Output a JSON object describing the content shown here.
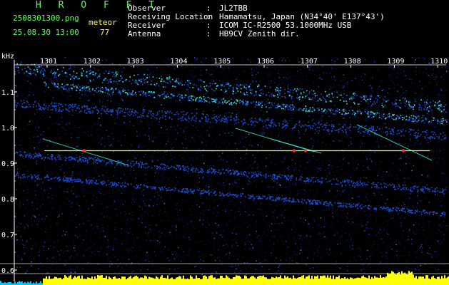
{
  "header": {
    "brand": "H R O F F T",
    "filename": "2508301300.png",
    "mode_label": "meteor",
    "datetime": "25.08.30 13:00",
    "count": "77"
  },
  "info": [
    {
      "key": "Observer",
      "value": "JL2TBB"
    },
    {
      "key": "Receiving Location",
      "value": "Hamamatsu, Japan (N34°40' E137°43')"
    },
    {
      "key": "Receiver",
      "value": "ICOM IC-R2500 53.1000MHz USB"
    },
    {
      "key": "Antenna",
      "value": "HB9CV Zenith dir."
    }
  ],
  "axis": {
    "unit": "kHz",
    "y_ticks": [
      "1.1",
      "1.0",
      "0.9",
      "0.8",
      "0.7",
      "0.6"
    ],
    "x_ticks": [
      "1301",
      "1302",
      "1303",
      "1304",
      "1305",
      "1306",
      "1307",
      "1308",
      "1309",
      "1310"
    ]
  },
  "colors": {
    "background": "#000000",
    "spectrum_low": "#0a1a6e",
    "spectrum_mid": "#1c4fd8",
    "spectrum_hot": "#3cf0d0",
    "carrier_line": "#c8ff50",
    "meteor_hit": "#ff3030",
    "level_bar": "#ffff00",
    "level_bar_low": "#00c8ff"
  }
}
